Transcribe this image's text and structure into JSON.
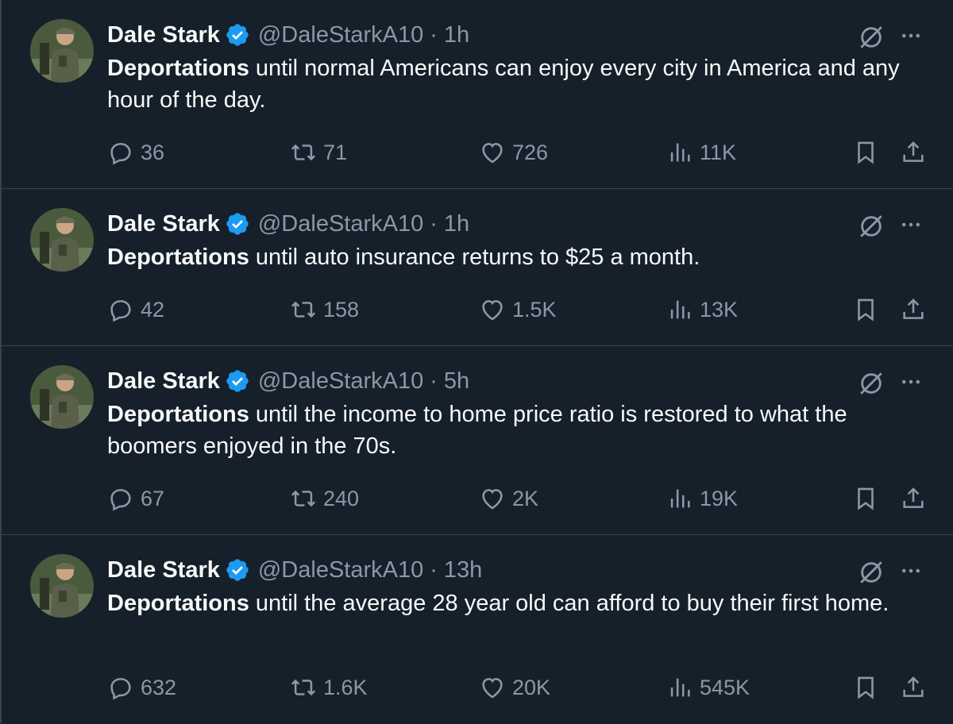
{
  "tweets": [
    {
      "name": "Dale Stark",
      "handle": "@DaleStarkA10",
      "separator": "·",
      "time": "1h",
      "bold": "Deportations",
      "text": " until normal Americans can enjoy every city in America and any hour of the day.",
      "replies": "36",
      "retweets": "71",
      "likes": "726",
      "views": "11K"
    },
    {
      "name": "Dale Stark",
      "handle": "@DaleStarkA10",
      "separator": "·",
      "time": "1h",
      "bold": "Deportations",
      "text": " until auto insurance returns to $25 a month.",
      "replies": "42",
      "retweets": "158",
      "likes": "1.5K",
      "views": "13K"
    },
    {
      "name": "Dale Stark",
      "handle": "@DaleStarkA10",
      "separator": "·",
      "time": "5h",
      "bold": "Deportations",
      "text": " until the income to home price ratio is restored to what the boomers enjoyed in the 70s.",
      "replies": "67",
      "retweets": "240",
      "likes": "2K",
      "views": "19K"
    },
    {
      "name": "Dale Stark",
      "handle": "@DaleStarkA10",
      "separator": "·",
      "time": "13h",
      "bold": "Deportations",
      "text": " until the average 28 year old can afford to buy their first home.",
      "replies": "632",
      "retweets": "1.6K",
      "likes": "20K",
      "views": "545K"
    }
  ],
  "icons": {
    "verified": "verified-badge-icon",
    "grok": "grok-icon",
    "more": "more-icon",
    "reply": "reply-icon",
    "retweet": "retweet-icon",
    "like": "heart-icon",
    "views": "views-icon",
    "bookmark": "bookmark-icon",
    "share": "share-icon"
  },
  "colors": {
    "background": "#15202b",
    "text": "#f7f9f9",
    "secondary": "#8b98a5",
    "verified": "#1d9bf0",
    "divider": "#38444d"
  }
}
